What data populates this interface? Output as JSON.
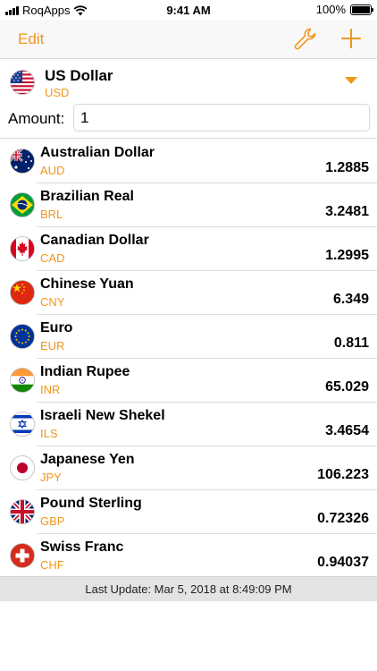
{
  "status_bar": {
    "carrier": "RoqApps",
    "time": "9:41 AM",
    "battery": "100%",
    "battery_level": 1.0
  },
  "nav": {
    "edit_label": "Edit",
    "settings_icon": "wrench-icon",
    "add_icon": "plus-icon"
  },
  "base": {
    "name": "US Dollar",
    "code": "USD",
    "flag_icon": "flag-us-icon"
  },
  "amount": {
    "label": "Amount:",
    "value": "1"
  },
  "currencies": [
    {
      "name": "Australian Dollar",
      "code": "AUD",
      "rate": "1.2885",
      "flag_icon": "flag-au-icon"
    },
    {
      "name": "Brazilian Real",
      "code": "BRL",
      "rate": "3.2481",
      "flag_icon": "flag-br-icon"
    },
    {
      "name": "Canadian Dollar",
      "code": "CAD",
      "rate": "1.2995",
      "flag_icon": "flag-ca-icon"
    },
    {
      "name": "Chinese Yuan",
      "code": "CNY",
      "rate": "6.349",
      "flag_icon": "flag-cn-icon"
    },
    {
      "name": "Euro",
      "code": "EUR",
      "rate": "0.811",
      "flag_icon": "flag-eu-icon"
    },
    {
      "name": "Indian Rupee",
      "code": "INR",
      "rate": "65.029",
      "flag_icon": "flag-in-icon"
    },
    {
      "name": "Israeli New Shekel",
      "code": "ILS",
      "rate": "3.4654",
      "flag_icon": "flag-il-icon"
    },
    {
      "name": "Japanese Yen",
      "code": "JPY",
      "rate": "106.223",
      "flag_icon": "flag-jp-icon"
    },
    {
      "name": "Pound Sterling",
      "code": "GBP",
      "rate": "0.72326",
      "flag_icon": "flag-gb-icon"
    },
    {
      "name": "Swiss Franc",
      "code": "CHF",
      "rate": "0.94037",
      "flag_icon": "flag-ch-icon"
    }
  ],
  "footer": {
    "last_update": "Last Update: Mar 5, 2018 at 8:49:09 PM"
  },
  "colors": {
    "accent": "#f0961a",
    "footer_bg": "#e3e3e3"
  }
}
